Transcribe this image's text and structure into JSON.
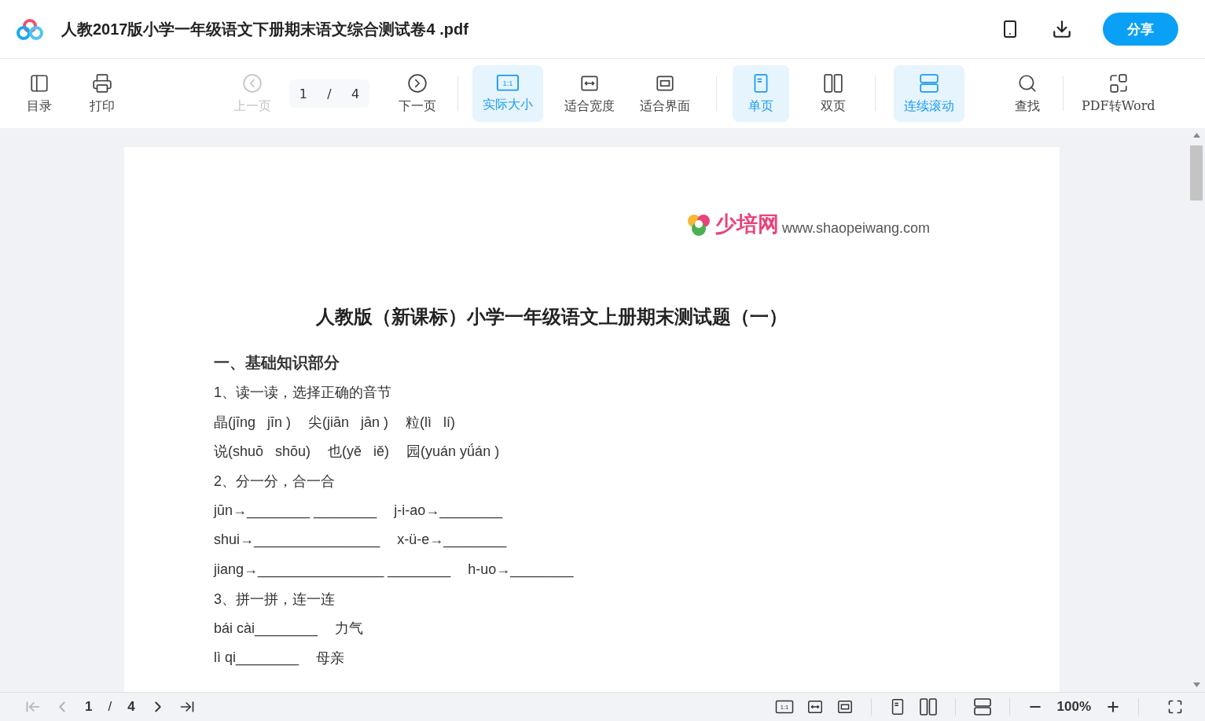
{
  "header": {
    "title": "人教2017版小学一年级语文下册期末语文综合测试卷4 .pdf",
    "share": "分享"
  },
  "toolbar": [
    {
      "kind": "toc",
      "label": "目录",
      "selected": false,
      "disabled": false
    },
    {
      "kind": "print",
      "label": "打印",
      "selected": false,
      "disabled": false
    },
    {
      "kind": "prev",
      "label": "上一页",
      "selected": false,
      "disabled": true
    },
    {
      "kind": "pager",
      "current": "1",
      "separator": "/",
      "total": "4"
    },
    {
      "kind": "next",
      "label": "下一页",
      "selected": false,
      "disabled": false
    },
    {
      "kind": "actual",
      "label": "实际大小",
      "icon_text": "1:1",
      "selected": true,
      "disabled": false
    },
    {
      "kind": "fitwidth",
      "label": "适合宽度",
      "selected": false,
      "disabled": false
    },
    {
      "kind": "fitpage",
      "label": "适合界面",
      "selected": false,
      "disabled": false
    },
    {
      "kind": "single",
      "label": "单页",
      "selected": true,
      "disabled": false
    },
    {
      "kind": "double",
      "label": "双页",
      "selected": false,
      "disabled": false
    },
    {
      "kind": "scroll",
      "label": "连续滚动",
      "selected": true,
      "disabled": false
    },
    {
      "kind": "search",
      "label": "查找",
      "selected": false,
      "disabled": false
    },
    {
      "kind": "convert",
      "label": "PDF转Word",
      "selected": false,
      "disabled": false
    }
  ],
  "document": {
    "logo_brand": "少培网",
    "logo_url": "www.shaopeiwang.com",
    "title": "人教版（新课标）小学一年级语文上册期末测试题（一）",
    "lines": [
      {
        "kind": "heading",
        "segments": [
          "一、基础知识部分"
        ]
      },
      {
        "kind": "text",
        "segments": [
          "1、读一读，选择正确的音节"
        ]
      },
      {
        "kind": "text",
        "segments": [
          "晶(jīng   jīn )",
          "尖(jiān   jān )",
          "粒(lì   lí)"
        ]
      },
      {
        "kind": "text",
        "segments": [
          "说(shuō   shōu)",
          "也(yě   iě)",
          "园(yuán yǘán )"
        ]
      },
      {
        "kind": "text",
        "segments": [
          "2、分一分，合一合"
        ]
      },
      {
        "kind": "text",
        "segments": [
          "jūn→________ ________",
          "j-i-ao→________"
        ]
      },
      {
        "kind": "text",
        "segments": [
          "shui→________________",
          "x-ü-e→________"
        ]
      },
      {
        "kind": "text",
        "segments": [
          "jiang→________________ ________",
          "h-uo→________"
        ]
      },
      {
        "kind": "text",
        "segments": [
          "3、拼一拼，连一连"
        ]
      },
      {
        "kind": "text",
        "segments": [
          "bái cài________",
          "力气"
        ]
      },
      {
        "kind": "text",
        "segments": [
          "lì qi________",
          "母亲"
        ]
      }
    ]
  },
  "bottom_bar": {
    "nav": [
      {
        "kind": "first",
        "disabled": true
      },
      {
        "kind": "prev",
        "disabled": true
      }
    ],
    "current": "1",
    "separator": "/",
    "total": "4",
    "nav_after": [
      {
        "kind": "next",
        "disabled": false
      },
      {
        "kind": "last",
        "disabled": false
      }
    ],
    "views": [
      {
        "kind": "actual",
        "icon_text": "1:1"
      },
      {
        "kind": "fitwidth"
      },
      {
        "kind": "fitpage"
      },
      {
        "kind": "divider"
      },
      {
        "kind": "single"
      },
      {
        "kind": "double"
      },
      {
        "kind": "divider"
      },
      {
        "kind": "scroll"
      },
      {
        "kind": "divider"
      }
    ],
    "zoom": "100%"
  }
}
